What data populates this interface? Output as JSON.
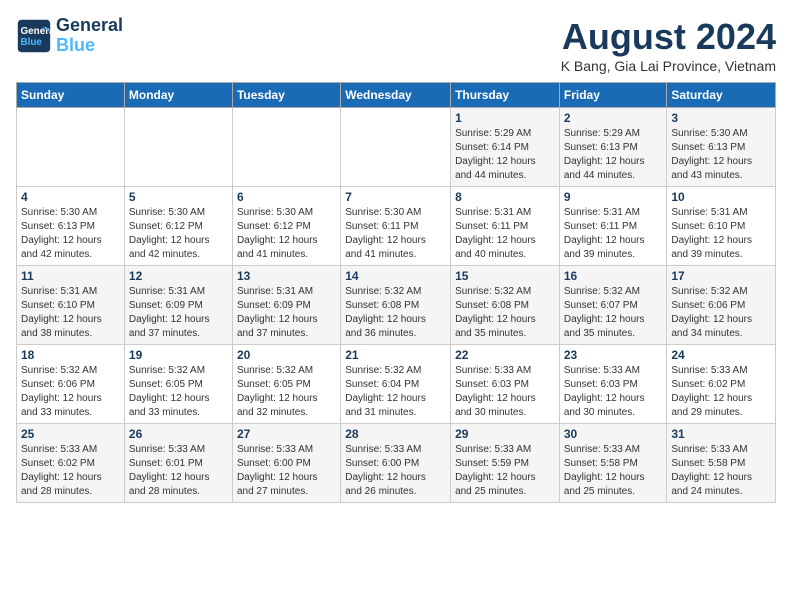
{
  "logo": {
    "line1": "General",
    "line2": "Blue"
  },
  "title": "August 2024",
  "location": "K Bang, Gia Lai Province, Vietnam",
  "days_of_week": [
    "Sunday",
    "Monday",
    "Tuesday",
    "Wednesday",
    "Thursday",
    "Friday",
    "Saturday"
  ],
  "weeks": [
    [
      {
        "day": "",
        "info": ""
      },
      {
        "day": "",
        "info": ""
      },
      {
        "day": "",
        "info": ""
      },
      {
        "day": "",
        "info": ""
      },
      {
        "day": "1",
        "info": "Sunrise: 5:29 AM\nSunset: 6:14 PM\nDaylight: 12 hours\nand 44 minutes."
      },
      {
        "day": "2",
        "info": "Sunrise: 5:29 AM\nSunset: 6:13 PM\nDaylight: 12 hours\nand 44 minutes."
      },
      {
        "day": "3",
        "info": "Sunrise: 5:30 AM\nSunset: 6:13 PM\nDaylight: 12 hours\nand 43 minutes."
      }
    ],
    [
      {
        "day": "4",
        "info": "Sunrise: 5:30 AM\nSunset: 6:13 PM\nDaylight: 12 hours\nand 42 minutes."
      },
      {
        "day": "5",
        "info": "Sunrise: 5:30 AM\nSunset: 6:12 PM\nDaylight: 12 hours\nand 42 minutes."
      },
      {
        "day": "6",
        "info": "Sunrise: 5:30 AM\nSunset: 6:12 PM\nDaylight: 12 hours\nand 41 minutes."
      },
      {
        "day": "7",
        "info": "Sunrise: 5:30 AM\nSunset: 6:11 PM\nDaylight: 12 hours\nand 41 minutes."
      },
      {
        "day": "8",
        "info": "Sunrise: 5:31 AM\nSunset: 6:11 PM\nDaylight: 12 hours\nand 40 minutes."
      },
      {
        "day": "9",
        "info": "Sunrise: 5:31 AM\nSunset: 6:11 PM\nDaylight: 12 hours\nand 39 minutes."
      },
      {
        "day": "10",
        "info": "Sunrise: 5:31 AM\nSunset: 6:10 PM\nDaylight: 12 hours\nand 39 minutes."
      }
    ],
    [
      {
        "day": "11",
        "info": "Sunrise: 5:31 AM\nSunset: 6:10 PM\nDaylight: 12 hours\nand 38 minutes."
      },
      {
        "day": "12",
        "info": "Sunrise: 5:31 AM\nSunset: 6:09 PM\nDaylight: 12 hours\nand 37 minutes."
      },
      {
        "day": "13",
        "info": "Sunrise: 5:31 AM\nSunset: 6:09 PM\nDaylight: 12 hours\nand 37 minutes."
      },
      {
        "day": "14",
        "info": "Sunrise: 5:32 AM\nSunset: 6:08 PM\nDaylight: 12 hours\nand 36 minutes."
      },
      {
        "day": "15",
        "info": "Sunrise: 5:32 AM\nSunset: 6:08 PM\nDaylight: 12 hours\nand 35 minutes."
      },
      {
        "day": "16",
        "info": "Sunrise: 5:32 AM\nSunset: 6:07 PM\nDaylight: 12 hours\nand 35 minutes."
      },
      {
        "day": "17",
        "info": "Sunrise: 5:32 AM\nSunset: 6:06 PM\nDaylight: 12 hours\nand 34 minutes."
      }
    ],
    [
      {
        "day": "18",
        "info": "Sunrise: 5:32 AM\nSunset: 6:06 PM\nDaylight: 12 hours\nand 33 minutes."
      },
      {
        "day": "19",
        "info": "Sunrise: 5:32 AM\nSunset: 6:05 PM\nDaylight: 12 hours\nand 33 minutes."
      },
      {
        "day": "20",
        "info": "Sunrise: 5:32 AM\nSunset: 6:05 PM\nDaylight: 12 hours\nand 32 minutes."
      },
      {
        "day": "21",
        "info": "Sunrise: 5:32 AM\nSunset: 6:04 PM\nDaylight: 12 hours\nand 31 minutes."
      },
      {
        "day": "22",
        "info": "Sunrise: 5:33 AM\nSunset: 6:03 PM\nDaylight: 12 hours\nand 30 minutes."
      },
      {
        "day": "23",
        "info": "Sunrise: 5:33 AM\nSunset: 6:03 PM\nDaylight: 12 hours\nand 30 minutes."
      },
      {
        "day": "24",
        "info": "Sunrise: 5:33 AM\nSunset: 6:02 PM\nDaylight: 12 hours\nand 29 minutes."
      }
    ],
    [
      {
        "day": "25",
        "info": "Sunrise: 5:33 AM\nSunset: 6:02 PM\nDaylight: 12 hours\nand 28 minutes."
      },
      {
        "day": "26",
        "info": "Sunrise: 5:33 AM\nSunset: 6:01 PM\nDaylight: 12 hours\nand 28 minutes."
      },
      {
        "day": "27",
        "info": "Sunrise: 5:33 AM\nSunset: 6:00 PM\nDaylight: 12 hours\nand 27 minutes."
      },
      {
        "day": "28",
        "info": "Sunrise: 5:33 AM\nSunset: 6:00 PM\nDaylight: 12 hours\nand 26 minutes."
      },
      {
        "day": "29",
        "info": "Sunrise: 5:33 AM\nSunset: 5:59 PM\nDaylight: 12 hours\nand 25 minutes."
      },
      {
        "day": "30",
        "info": "Sunrise: 5:33 AM\nSunset: 5:58 PM\nDaylight: 12 hours\nand 25 minutes."
      },
      {
        "day": "31",
        "info": "Sunrise: 5:33 AM\nSunset: 5:58 PM\nDaylight: 12 hours\nand 24 minutes."
      }
    ]
  ]
}
